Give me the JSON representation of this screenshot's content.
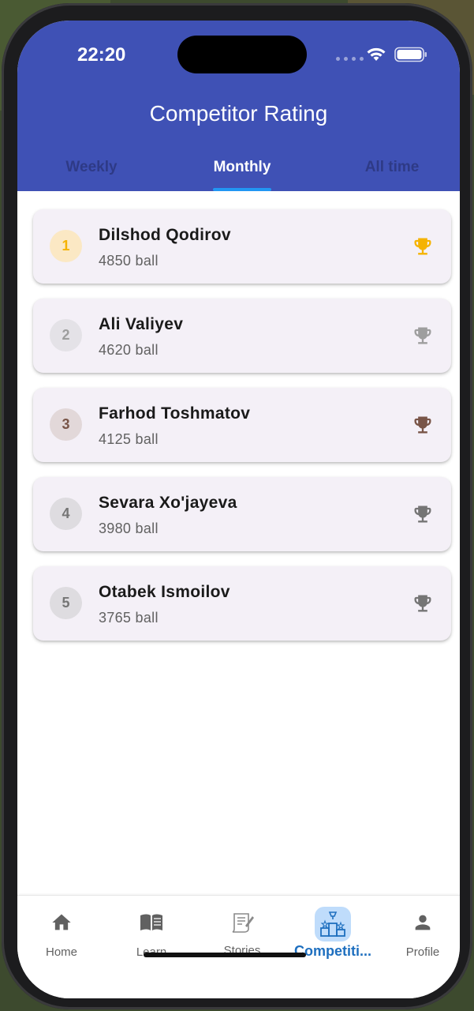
{
  "status_bar": {
    "time": "22:20"
  },
  "header": {
    "title": "Competitor Rating",
    "tabs": [
      {
        "label": "Weekly",
        "active": false
      },
      {
        "label": "Monthly",
        "active": true
      },
      {
        "label": "All time",
        "active": false
      }
    ]
  },
  "competitors": [
    {
      "rank": "1",
      "name": "Dilshod Qodirov",
      "score": "4850 ball",
      "trophy_color": "#f5b301"
    },
    {
      "rank": "2",
      "name": "Ali Valiyev",
      "score": "4620 ball",
      "trophy_color": "#9e9e9e"
    },
    {
      "rank": "3",
      "name": "Farhod Toshmatov",
      "score": "4125 ball",
      "trophy_color": "#795548"
    },
    {
      "rank": "4",
      "name": "Sevara Xo'jayeva",
      "score": "3980 ball",
      "trophy_color": "#757575"
    },
    {
      "rank": "5",
      "name": "Otabek Ismoilov",
      "score": "3765 ball",
      "trophy_color": "#757575"
    }
  ],
  "bottom_nav": {
    "items": [
      {
        "label": "Home",
        "icon": "home-icon",
        "active": false
      },
      {
        "label": "Learn",
        "icon": "book-icon",
        "active": false
      },
      {
        "label": "Stories",
        "icon": "stories-icon",
        "active": false
      },
      {
        "label": "Competiti...",
        "icon": "podium-icon",
        "active": true
      },
      {
        "label": "Profile",
        "icon": "person-icon",
        "active": false
      }
    ]
  },
  "colors": {
    "app_bar": "#3f51b5",
    "tab_indicator": "#2196f3",
    "card_background": "#f4f0f7",
    "active_nav": "#1e6fbf",
    "active_nav_pill": "#bfdcfb"
  }
}
